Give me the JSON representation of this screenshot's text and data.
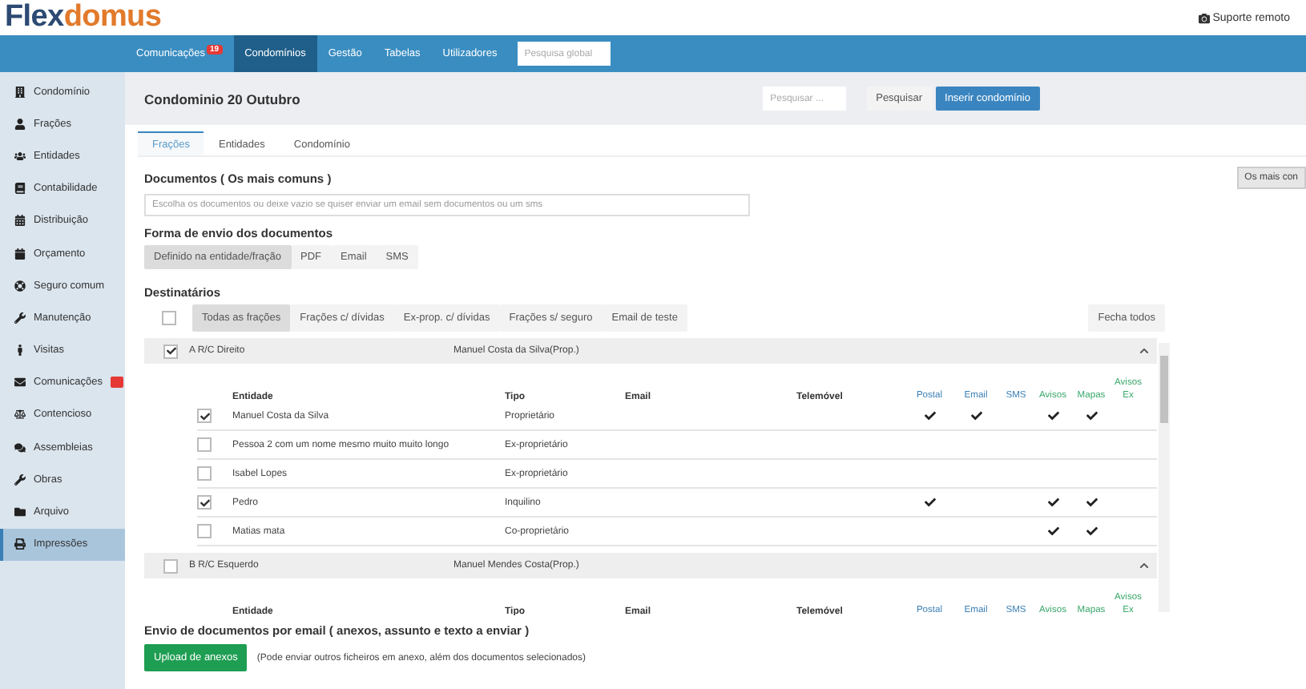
{
  "logo": {
    "part1": "Flex",
    "part2": "domus"
  },
  "support": "Suporte remoto",
  "nav": {
    "items": [
      {
        "label": "Comunicações",
        "badge": "19",
        "selected": false
      },
      {
        "label": "Condomínios",
        "selected": true
      },
      {
        "label": "Gestão",
        "selected": false
      },
      {
        "label": "Tabelas",
        "selected": false
      },
      {
        "label": "Utilizadores",
        "selected": false
      }
    ],
    "search_placeholder": "Pesquisa global"
  },
  "sidebar": {
    "items": [
      {
        "label": "Condomínio",
        "selected": false
      },
      {
        "label": "Frações",
        "selected": false
      },
      {
        "label": "Entidades",
        "selected": false
      },
      {
        "label": "Contabilidade",
        "selected": false
      },
      {
        "label": "Distribuição",
        "selected": false
      },
      {
        "label": "Orçamento",
        "selected": false
      },
      {
        "label": "Seguro comum",
        "selected": false
      },
      {
        "label": "Manutenção",
        "selected": false
      },
      {
        "label": "Visitas",
        "selected": false
      },
      {
        "label": "Comunicações",
        "badge": true,
        "selected": false
      },
      {
        "label": "Contencioso",
        "selected": false
      },
      {
        "label": "Assembleias",
        "selected": false
      },
      {
        "label": "Obras",
        "selected": false
      },
      {
        "label": "Arquivo",
        "selected": false
      },
      {
        "label": "Impressões",
        "selected": true
      }
    ]
  },
  "header": {
    "title": "Condominio 20 Outubro",
    "search_placeholder": "Pesquisar ...",
    "search_button": "Pesquisar",
    "insert_button": "Inserir condomínio"
  },
  "tabs": [
    {
      "label": "Frações",
      "selected": true
    },
    {
      "label": "Entidades",
      "selected": false
    },
    {
      "label": "Condomínio",
      "selected": false
    }
  ],
  "documents": {
    "title": "Documentos ( Os mais comuns )",
    "placeholder": "Escolha os documentos ou deixe vazio se quiser enviar um email sem documentos ou um sms",
    "side_button": "Os mais con"
  },
  "send_method": {
    "title": "Forma de envio dos documentos",
    "options": [
      {
        "label": "Definido na entidade/fração",
        "selected": true
      },
      {
        "label": "PDF",
        "selected": false
      },
      {
        "label": "Email",
        "selected": false
      },
      {
        "label": "SMS",
        "selected": false
      }
    ]
  },
  "recipients": {
    "title": "Destinatários",
    "select_all": false,
    "filters": [
      {
        "label": "Todas as frações",
        "selected": true
      },
      {
        "label": "Frações c/ dívidas",
        "selected": false
      },
      {
        "label": "Ex-prop. c/ dívidas",
        "selected": false
      },
      {
        "label": "Frações s/ seguro",
        "selected": false
      },
      {
        "label": "Email de teste",
        "selected": false
      }
    ],
    "close_all": "Fecha todos",
    "fractions": [
      {
        "name": "A R/C Direito",
        "owner": "Manuel Costa da Silva(Prop.)",
        "checked": true,
        "expanded": true,
        "columns": [
          "Entidade",
          "Tipo",
          "Email",
          "Telemóvel"
        ],
        "channel_columns": [
          {
            "kind": "postal",
            "label": "Postal",
            "color": "#3a7fb5"
          },
          {
            "kind": "email",
            "label": "Email",
            "color": "#3a7fb5"
          },
          {
            "kind": "sms",
            "label": "SMS",
            "color": "#3a7fb5"
          },
          {
            "kind": "avisos",
            "label": "Avisos",
            "color": "#3aa86b"
          },
          {
            "kind": "mapas",
            "label": "Mapas",
            "color": "#3aa86b"
          },
          {
            "kind": "avisos_ex",
            "label": "Avisos Ex",
            "color": "#3aa86b"
          }
        ],
        "rows": [
          {
            "entity": "Manuel Costa da Silva",
            "type": "Proprietário",
            "checked": true,
            "channels": {
              "postal": true,
              "email": true,
              "avisos": true,
              "mapas": true
            }
          },
          {
            "entity": "Pessoa 2 com um nome mesmo muito muito longo",
            "type": "Ex-proprietário",
            "checked": false
          },
          {
            "entity": "Isabel Lopes",
            "type": "Ex-proprietário",
            "checked": false
          },
          {
            "entity": "Pedro",
            "type": "Inquilino",
            "checked": true,
            "channels": {
              "postal": true,
              "avisos": true,
              "mapas": true
            }
          },
          {
            "entity": "Matias mata",
            "type": "Co-proprietário",
            "checked": false,
            "channels": {
              "avisos": true,
              "mapas": true
            }
          }
        ]
      },
      {
        "name": "B R/C Esquerdo",
        "owner": "Manuel Mendes Costa(Prop.)",
        "checked": false,
        "expanded": true,
        "columns": [
          "Entidade",
          "Tipo",
          "Email",
          "Telemóvel"
        ],
        "channel_columns": [
          {
            "label": "Postal",
            "color": "#3a7fb5"
          },
          {
            "label": "Email",
            "color": "#3a7fb5"
          },
          {
            "label": "SMS",
            "color": "#3a7fb5"
          },
          {
            "label": "Avisos",
            "color": "#3aa86b"
          },
          {
            "label": "Mapas",
            "color": "#3aa86b"
          },
          {
            "label": "Avisos Ex",
            "color": "#3aa86b"
          }
        ]
      }
    ]
  },
  "email_section": {
    "title": "Envio de documentos por email ( anexos, assunto e texto a enviar )",
    "upload_button": "Upload de anexos",
    "note": "(Pode enviar outros ficheiros em anexo, além dos documentos selecionados)"
  }
}
